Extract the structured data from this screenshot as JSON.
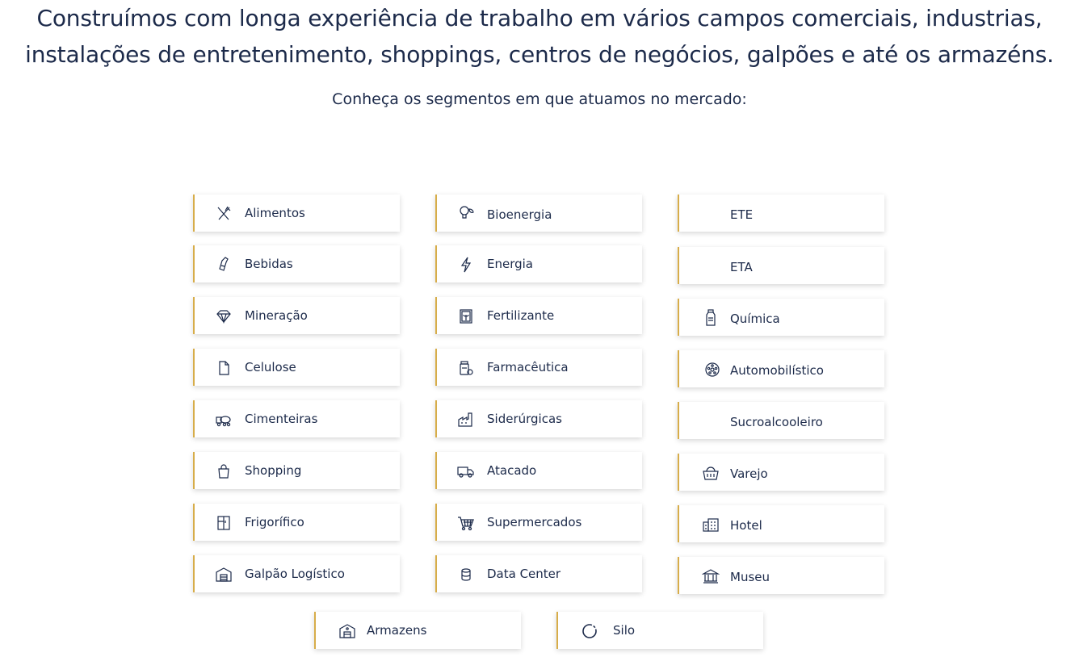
{
  "intro": {
    "headline_line1": "Construímos com longa experiência de trabalho em vários campos comerciais, industrias,",
    "headline_line2": "instalações de entretenimento, shoppings, centros de negócios, galpões e até os armazéns.",
    "subtitle": "Conheça os segmentos em que atuamos no mercado:"
  },
  "colors": {
    "accent": "#d7ad4a",
    "text": "#1c2a4a"
  },
  "segments": {
    "col1": [
      {
        "label": "Alimentos",
        "icon": "utensils-icon"
      },
      {
        "label": "Bebidas",
        "icon": "bottle-icon"
      },
      {
        "label": "Mineração",
        "icon": "diamond-icon"
      },
      {
        "label": "Celulose",
        "icon": "document-icon"
      },
      {
        "label": "Cimenteiras",
        "icon": "cement-truck-icon"
      },
      {
        "label": "Shopping",
        "icon": "shopping-bag-icon"
      },
      {
        "label": "Frigorífico",
        "icon": "fridge-icon"
      },
      {
        "label": "Galpão Logístico",
        "icon": "warehouse-icon"
      }
    ],
    "col2": [
      {
        "label": "Bioenergia",
        "icon": "bio-bulb-icon"
      },
      {
        "label": "Energia",
        "icon": "lightning-icon"
      },
      {
        "label": "Fertilizante",
        "icon": "plant-box-icon"
      },
      {
        "label": "Farmacêutica",
        "icon": "pill-bottle-icon"
      },
      {
        "label": "Siderúrgicas",
        "icon": "factory-icon"
      },
      {
        "label": "Atacado",
        "icon": "delivery-truck-icon"
      },
      {
        "label": "Supermercados",
        "icon": "shopping-cart-icon"
      },
      {
        "label": "Data Center",
        "icon": "database-icon"
      }
    ],
    "col3": [
      {
        "label": "ETE",
        "icon": ""
      },
      {
        "label": "ETA",
        "icon": ""
      },
      {
        "label": "Química",
        "icon": "chemical-bottle-icon"
      },
      {
        "label": "Automobilístico",
        "icon": "wheel-icon"
      },
      {
        "label": "Sucroalcooleiro",
        "icon": ""
      },
      {
        "label": "Varejo",
        "icon": "basket-icon"
      },
      {
        "label": "Hotel",
        "icon": "hotel-building-icon"
      },
      {
        "label": "Museu",
        "icon": "museum-icon"
      }
    ],
    "bottom": [
      {
        "label": "Armazens",
        "icon": "storage-building-icon"
      },
      {
        "label": "Silo",
        "icon": "loading-circle-icon"
      }
    ]
  }
}
